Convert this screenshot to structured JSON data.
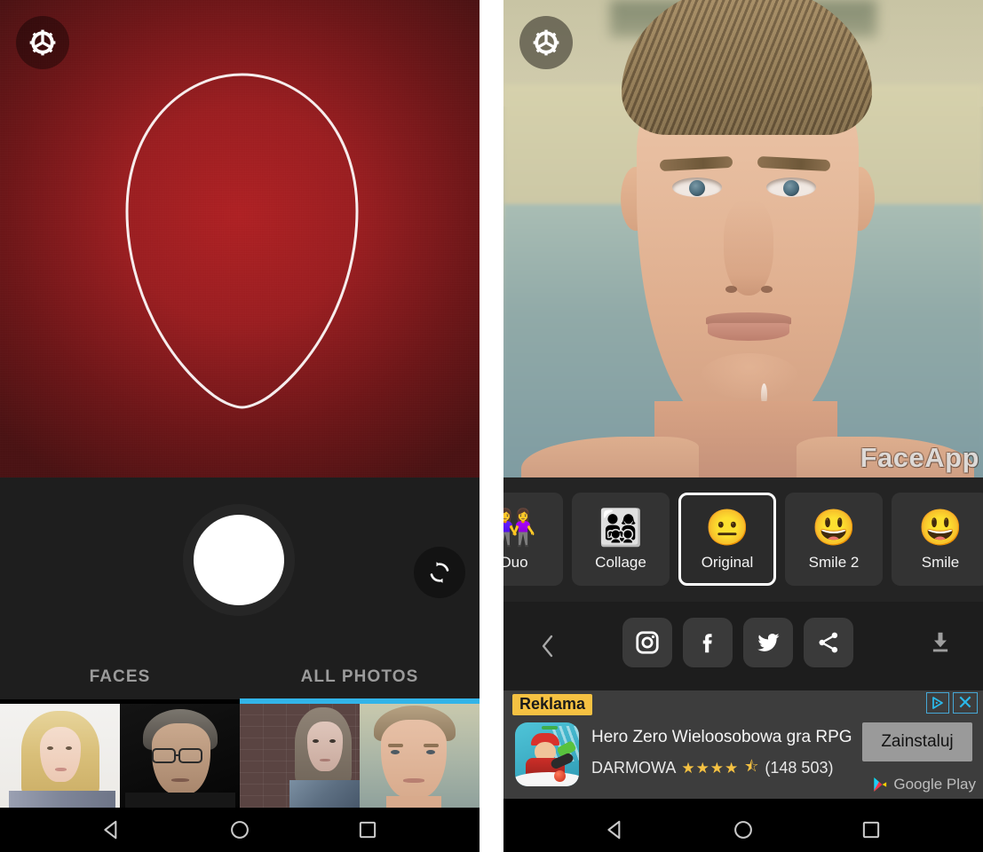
{
  "app": {
    "name": "FaceApp",
    "watermark": "FaceApp"
  },
  "left_screen": {
    "name": "camera-capture-screen",
    "settings_icon": "gear-icon",
    "face_guide": "face-outline-guide",
    "shutter": "shutter-button",
    "flip_camera_icon": "flip-camera-icon",
    "tabs": [
      {
        "label": "FACES",
        "selected": false
      },
      {
        "label": "ALL PHOTOS",
        "selected": true
      }
    ],
    "tab_indicator_color": "#32b4e8",
    "thumbnails": [
      {
        "name": "thumbnail-blonde-woman"
      },
      {
        "name": "thumbnail-older-man-glasses"
      },
      {
        "name": "thumbnail-girl-brick-wall"
      },
      {
        "name": "thumbnail-young-man"
      }
    ]
  },
  "right_screen": {
    "name": "photo-editor-screen",
    "settings_icon": "gear-icon",
    "filters": [
      {
        "label": "Duo",
        "emoji": "👭",
        "selected": false
      },
      {
        "label": "Collage",
        "emoji": "👨‍👩‍👧‍👦",
        "selected": false
      },
      {
        "label": "Original",
        "emoji": "😐",
        "selected": true
      },
      {
        "label": "Smile 2",
        "emoji": "😃",
        "selected": false
      },
      {
        "label": "Smile",
        "emoji": "😃",
        "selected": false
      }
    ],
    "selected_filter": "Original",
    "share_row": {
      "back_icon": "chevron-left-icon",
      "buttons": [
        {
          "name": "instagram-icon"
        },
        {
          "name": "facebook-icon"
        },
        {
          "name": "twitter-icon"
        },
        {
          "name": "share-icon"
        }
      ],
      "download_icon": "download-icon"
    },
    "ad": {
      "tag": "Reklama",
      "tag_color": "#f5c142",
      "title": "Hero Zero Wieloosobowa gra RPG",
      "price": "DARMOWA",
      "stars": "★★★★",
      "half_star": "⯪",
      "reviews": "(148 503)",
      "cta": "Zainstaluj",
      "store": "Google Play",
      "adchoices_icon": "adchoices-icon",
      "close_icon": "close-icon",
      "accent_color": "#2bb8e8"
    }
  },
  "navbar": {
    "back": "back-triangle-icon",
    "home": "home-circle-icon",
    "recents": "recents-square-icon"
  }
}
